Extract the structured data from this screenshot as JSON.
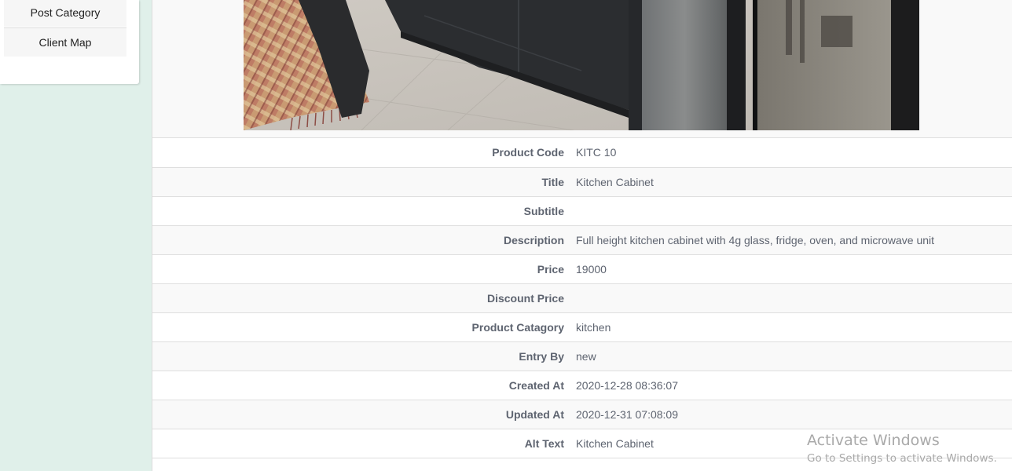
{
  "sidebar": {
    "items": [
      {
        "label": "Post Category"
      },
      {
        "label": "Client Map"
      }
    ]
  },
  "product": {
    "image_alt": "Kitchen Cabinet",
    "fields": [
      {
        "label": "Product Code",
        "value": "KITC 10"
      },
      {
        "label": "Title",
        "value": "Kitchen Cabinet"
      },
      {
        "label": "Subtitle",
        "value": ""
      },
      {
        "label": "Description",
        "value": "Full height kitchen cabinet with 4g glass, fridge, oven, and microwave unit"
      },
      {
        "label": "Price",
        "value": "19000"
      },
      {
        "label": "Discount Price",
        "value": ""
      },
      {
        "label": "Product Catagory",
        "value": "kitchen"
      },
      {
        "label": "Entry By",
        "value": "new"
      },
      {
        "label": "Created At",
        "value": "2020-12-28 08:36:07"
      },
      {
        "label": "Updated At",
        "value": "2020-12-31 07:08:09"
      },
      {
        "label": "Alt Text",
        "value": "Kitchen Cabinet"
      }
    ]
  },
  "watermark": {
    "title": "Activate Windows",
    "subtitle": "Go to Settings to activate Windows."
  }
}
